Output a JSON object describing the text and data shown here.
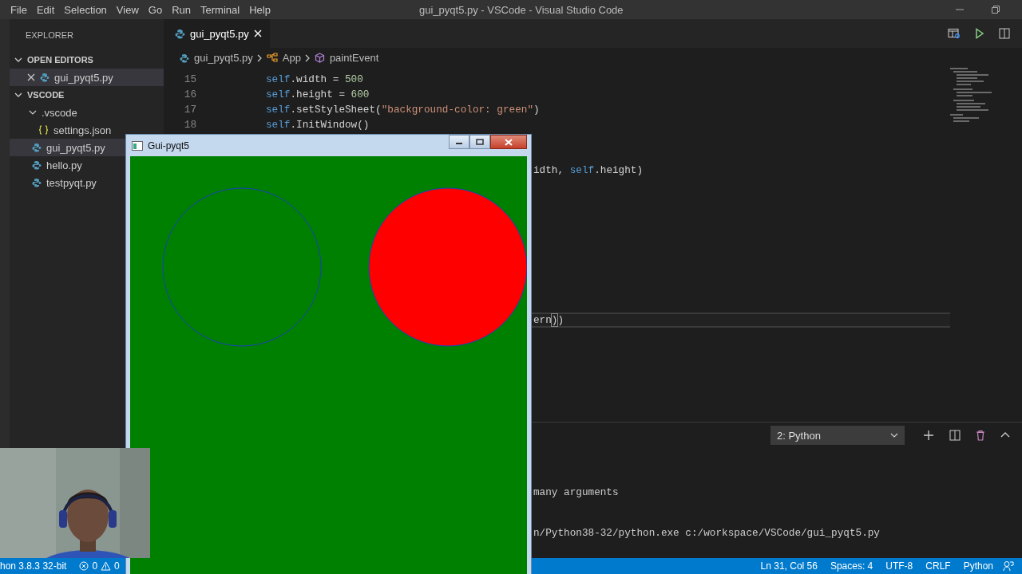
{
  "menu": [
    "File",
    "Edit",
    "Selection",
    "View",
    "Go",
    "Run",
    "Terminal",
    "Help"
  ],
  "window": {
    "title": "gui_pyqt5.py - VSCode - Visual Studio Code"
  },
  "sidebar": {
    "title": "EXPLORER",
    "sections": [
      {
        "title": "OPEN EDITORS",
        "expanded": true,
        "items": [
          {
            "name": "gui_pyqt5.py",
            "kind": "python",
            "selected": true
          }
        ]
      },
      {
        "title": "VSCODE",
        "expanded": true,
        "items": [
          {
            "name": ".vscode",
            "kind": "folder",
            "expanded": true,
            "selected": false,
            "children": [
              {
                "name": "settings.json",
                "kind": "json",
                "selected": false
              }
            ]
          },
          {
            "name": "gui_pyqt5.py",
            "kind": "python",
            "selected": true
          },
          {
            "name": "hello.py",
            "kind": "python",
            "selected": false
          },
          {
            "name": "testpyqt.py",
            "kind": "python",
            "selected": false
          }
        ]
      }
    ]
  },
  "tabs": [
    {
      "label": "gui_pyqt5.py",
      "selected": true
    }
  ],
  "breadcrumb": [
    {
      "label": "gui_pyqt5.py",
      "kind": "file"
    },
    {
      "label": "App",
      "kind": "class"
    },
    {
      "label": "paintEvent",
      "kind": "method"
    }
  ],
  "editor": {
    "lines": [
      {
        "number": "15",
        "tokens": [
          {
            "kind": "self",
            "text": "self"
          },
          {
            "kind": "plain",
            "text": ".width = "
          },
          {
            "kind": "number",
            "text": "500"
          }
        ]
      },
      {
        "number": "16",
        "tokens": [
          {
            "kind": "self",
            "text": "self"
          },
          {
            "kind": "plain",
            "text": ".height = "
          },
          {
            "kind": "number",
            "text": "600"
          }
        ]
      },
      {
        "number": "17",
        "tokens": [
          {
            "kind": "self",
            "text": "self"
          },
          {
            "kind": "plain",
            "text": ".setStyleSheet("
          },
          {
            "kind": "string",
            "text": "\"background-color: green\""
          },
          {
            "kind": "plain",
            "text": ")"
          }
        ]
      },
      {
        "number": "18",
        "tokens": [
          {
            "kind": "self",
            "text": "self"
          },
          {
            "kind": "plain",
            "text": ".InitWindow()"
          }
        ]
      }
    ],
    "fragments": [
      {
        "current": false,
        "tokens": [
          {
            "kind": "plain",
            "text": "idth, "
          },
          {
            "kind": "self",
            "text": "self"
          },
          {
            "kind": "plain",
            "text": ".height)"
          }
        ]
      },
      {
        "current": true,
        "tokens": [
          {
            "kind": "plain",
            "text": "ern"
          },
          {
            "kind": "bracket",
            "text": ")"
          },
          {
            "kind": "plain",
            "text": ")"
          }
        ]
      }
    ]
  },
  "panel": {
    "terminal_select": "2: Python",
    "lines": [
      "many arguments",
      "n/Python38-32/python.exe c:/workspace/VSCode/gui_pyqt5.py"
    ]
  },
  "status_bar": {
    "interpreter": "hon 3.8.3 32-bit",
    "errors": "0",
    "warnings": "0",
    "right": [
      "Ln 31, Col 56",
      "Spaces: 4",
      "UTF-8",
      "CRLF",
      "Python"
    ]
  },
  "app_window": {
    "title": "Gui-pyqt5"
  }
}
